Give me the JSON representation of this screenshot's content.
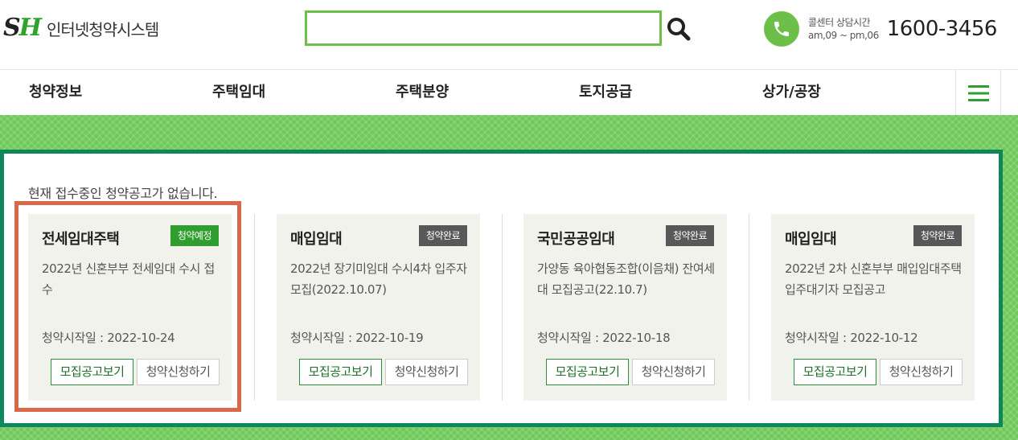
{
  "header": {
    "logo_mark_s": "S",
    "logo_mark_h": "H",
    "logo_text": "인터넷청약시스템",
    "search": {
      "value": "",
      "placeholder": ""
    },
    "callcenter": {
      "label_line1": "콜센터 상담시간",
      "label_line2": "am,09 ~ pm,06",
      "number": "1600-3456"
    }
  },
  "nav": {
    "items": [
      "청약정보",
      "주택임대",
      "주택분양",
      "토지공급",
      "상가/공장"
    ]
  },
  "main": {
    "notice": "현재 접수중인 청약공고가 없습니다.",
    "cards": [
      {
        "title": "전세임대주택",
        "status": "청약예정",
        "description": "2022년 신혼부부 전세임대 수시 접수",
        "start_date": "청약시작일 : 2022-10-24",
        "view_label": "모집공고보기",
        "apply_label": "청약신청하기"
      },
      {
        "title": "매입임대",
        "status": "청약완료",
        "description": "2022년 장기미임대 수시4차 입주자모집(2022.10.07)",
        "start_date": "청약시작일 : 2022-10-19",
        "view_label": "모집공고보기",
        "apply_label": "청약신청하기"
      },
      {
        "title": "국민공공임대",
        "status": "청약완료",
        "description": "가양동 육아협동조합(이음채) 잔여세대 모집공고(22.10.7)",
        "start_date": "청약시작일 : 2022-10-18",
        "view_label": "모집공고보기",
        "apply_label": "청약신청하기"
      },
      {
        "title": "매입임대",
        "status": "청약완료",
        "description": "2022년 2차 신혼부부 매입임대주택 입주대기자 모집공고",
        "start_date": "청약시작일 : 2022-10-12",
        "view_label": "모집공고보기",
        "apply_label": "청약신청하기"
      }
    ]
  },
  "colors": {
    "brand_green": "#6cc04a",
    "panel_border": "#10875a",
    "badge_upcoming": "#2f9e2f",
    "badge_closed": "#585858",
    "highlight": "#d9674a"
  }
}
